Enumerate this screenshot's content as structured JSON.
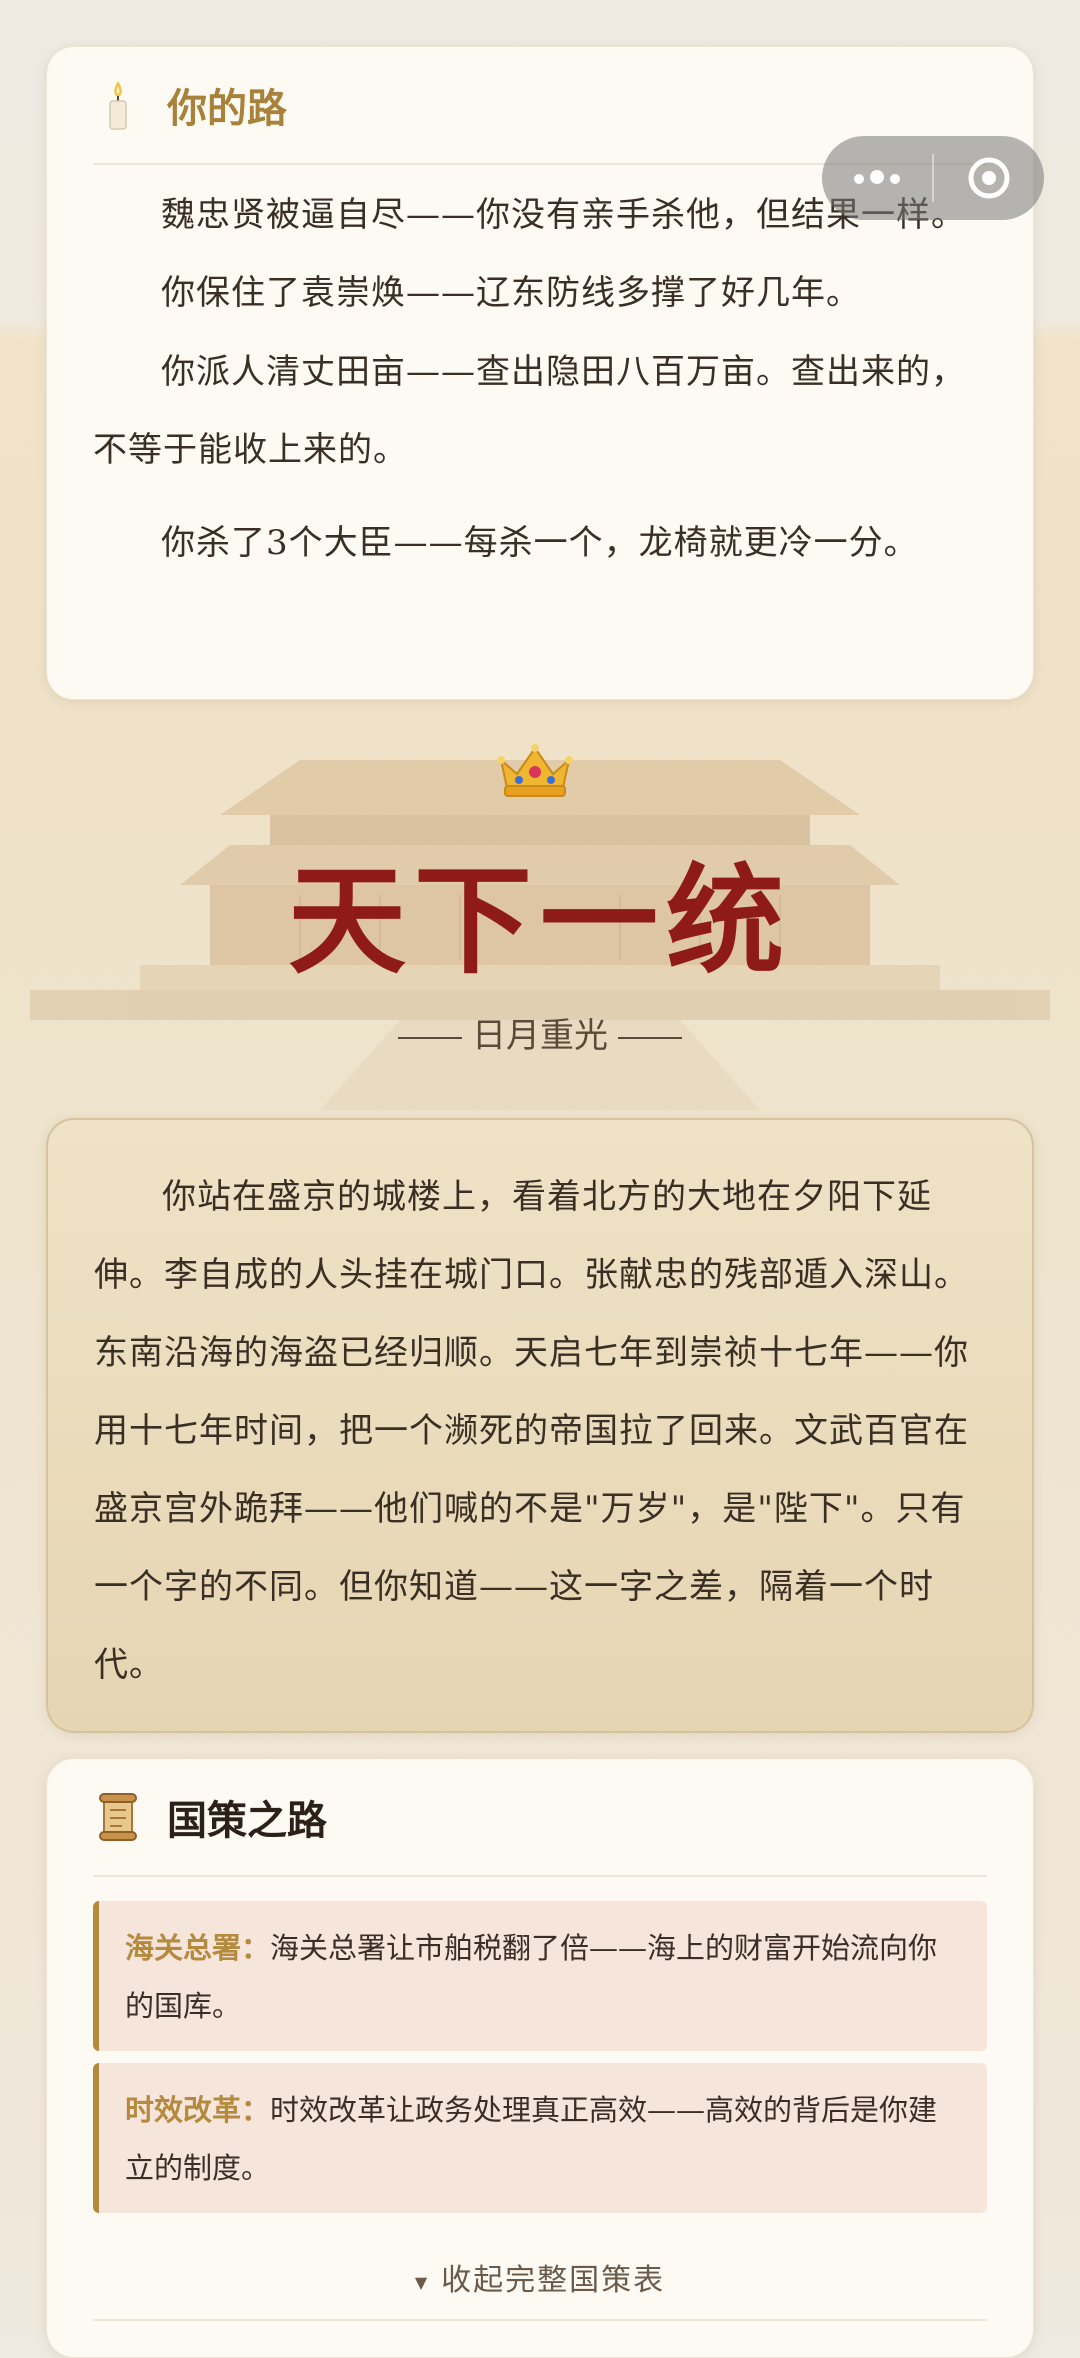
{
  "path_card": {
    "title": "你的路",
    "icon": "candle-icon",
    "paragraphs": [
      "魏忠贤被逼自尽——你没有亲手杀他，但结果一样。",
      "你保住了袁崇焕——辽东防线多撑了好几年。",
      "你派人清丈田亩——查出隐田八百万亩。查出来的，不等于能收上来的。",
      "你杀了3个大臣——每杀一个，龙椅就更冷一分。"
    ]
  },
  "capsule": {
    "more_icon": "more-dots-icon",
    "close_icon": "target-close-icon"
  },
  "hero": {
    "crown_icon": "crown-icon",
    "title": "天下一统",
    "subtitle": "日月重光"
  },
  "story": {
    "text": "你站在盛京的城楼上，看着北方的大地在夕阳下延伸。李自成的人头挂在城门口。张献忠的残部遁入深山。东南沿海的海盗已经归顺。天启七年到崇祯十七年——你用十七年时间，把一个濒死的帝国拉了回来。文武百官在盛京宫外跪拜——他们喊的不是\"万岁\"，是\"陛下\"。只有一个字的不同。但你知道——这一字之差，隔着一个时代。"
  },
  "policy_card": {
    "title": "国策之路",
    "icon": "scroll-icon",
    "items": [
      {
        "name": "海关总署：",
        "text": "海关总署让市舶税翻了倍——海上的财富开始流向你的国库。"
      },
      {
        "name": "时效改革：",
        "text": "时效改革让政务处理真正高效——高效的背后是你建立的制度。"
      }
    ],
    "collapse_label": "收起完整国策表"
  },
  "colors": {
    "accent_gold": "#a8813a",
    "title_red": "#8e1b17",
    "policy_bg": "#f6e5da"
  }
}
